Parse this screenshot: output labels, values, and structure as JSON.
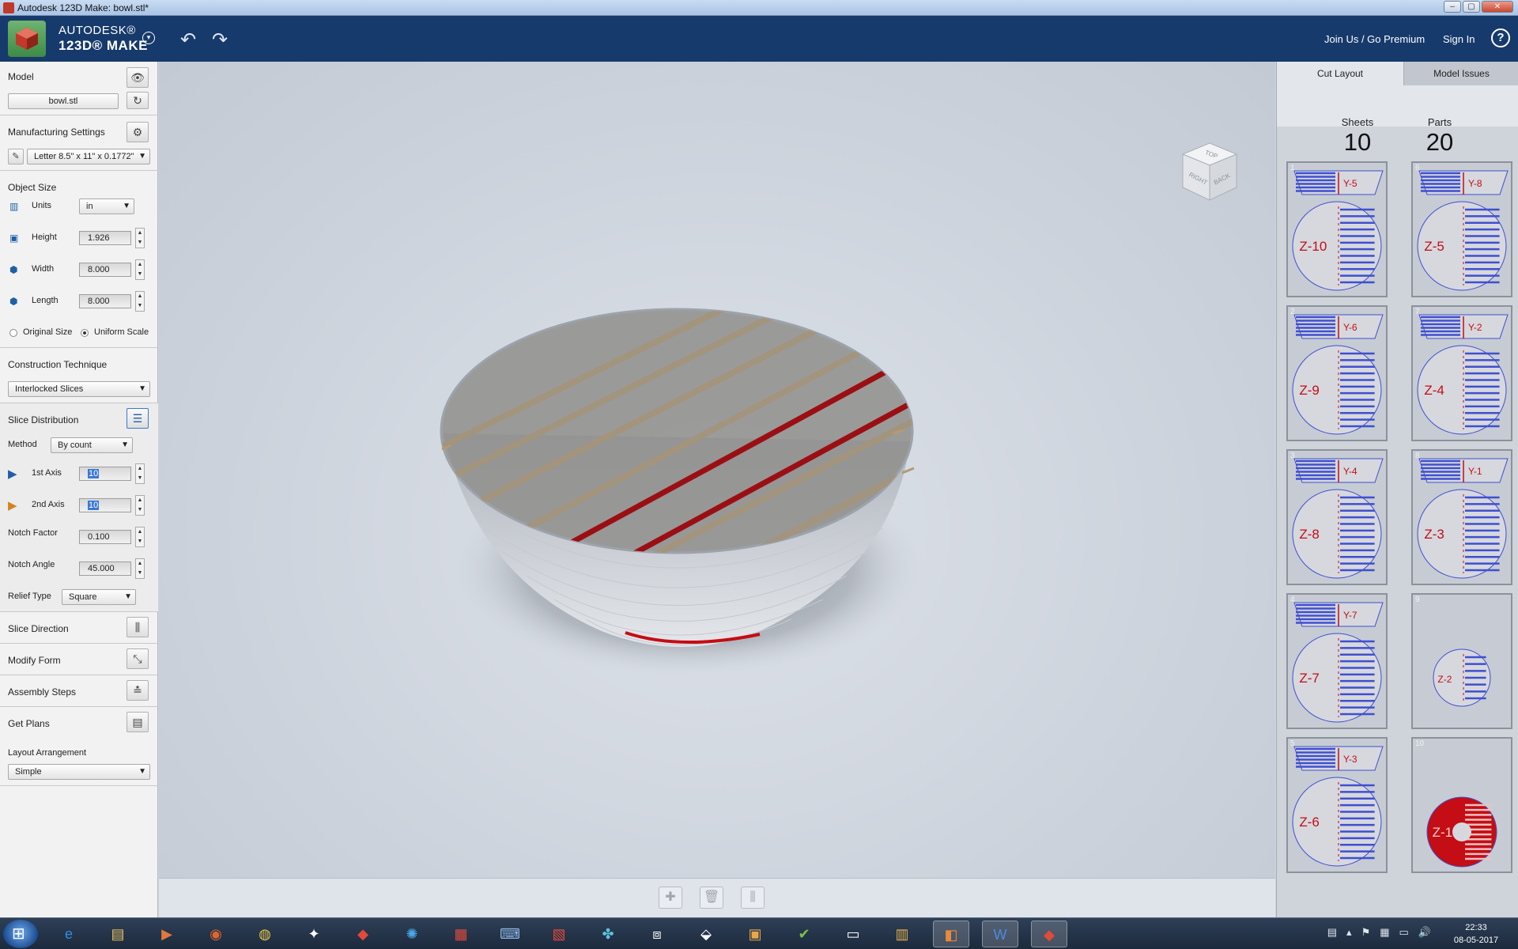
{
  "window": {
    "title": "Autodesk 123D Make: bowl.stl*",
    "buttons": [
      "–",
      "▢",
      "✕"
    ]
  },
  "header": {
    "brand_line1": "AUTODESK®",
    "brand_line2": "123D® MAKE",
    "undo_icon": "undo-arrow-icon",
    "redo_icon": "redo-arrow-icon",
    "join_link": "Join Us / Go Premium",
    "signin_link": "Sign In",
    "help_label": "?"
  },
  "left_panel": {
    "model": {
      "title": "Model",
      "file_button": "bowl.stl"
    },
    "manufacturing": {
      "title": "Manufacturing Settings",
      "sheet_value": "Letter 8.5\" x 11\" x 0.1772\""
    },
    "object_size": {
      "title": "Object Size",
      "units_label": "Units",
      "units_value": "in",
      "height_label": "Height",
      "height_value": "1.926",
      "width_label": "Width",
      "width_value": "8.000",
      "length_label": "Length",
      "length_value": "8.000",
      "original_size_label": "Original Size",
      "uniform_scale_label": "Uniform Scale",
      "selected_scale": "Uniform Scale"
    },
    "construction": {
      "title": "Construction Technique",
      "value": "Interlocked Slices"
    },
    "slice_distribution": {
      "title": "Slice Distribution",
      "method_label": "Method",
      "method_value": "By count",
      "axis1_label": "1st Axis",
      "axis1_value": "10",
      "axis2_label": "2nd Axis",
      "axis2_value": "10",
      "notch_factor_label": "Notch Factor",
      "notch_factor_value": "0.100",
      "notch_angle_label": "Notch Angle",
      "notch_angle_value": "45.000",
      "relief_label": "Relief Type",
      "relief_value": "Square"
    },
    "slice_direction": "Slice Direction",
    "modify_form": "Modify Form",
    "assembly_steps": "Assembly Steps",
    "get_plans": "Get Plans",
    "layout": {
      "title": "Layout Arrangement",
      "value": "Simple"
    }
  },
  "viewcube": {
    "faces": [
      "RIGHT",
      "BACK",
      "TOP"
    ]
  },
  "right_panel": {
    "tabs": [
      "Cut Layout",
      "Model Issues"
    ],
    "active_tab": "Cut Layout",
    "sheets_label": "Sheets",
    "sheets_value": "10",
    "parts_label": "Parts",
    "parts_value": "20",
    "thumbnails": [
      {
        "num": "1",
        "slice_label": "Y-5",
        "disc_label": "Z-10"
      },
      {
        "num": "6",
        "slice_label": "Y-8",
        "disc_label": "Z-5"
      },
      {
        "num": "2",
        "slice_label": "Y-6",
        "disc_label": "Z-9"
      },
      {
        "num": "7",
        "slice_label": "Y-2",
        "disc_label": "Z-4"
      },
      {
        "num": "3",
        "slice_label": "Y-4",
        "disc_label": "Z-8"
      },
      {
        "num": "8",
        "slice_label": "Y-1",
        "disc_label": "Z-3"
      },
      {
        "num": "4",
        "slice_label": "Y-7",
        "disc_label": "Z-7"
      },
      {
        "num": "9",
        "slice_label": "",
        "disc_label": "Z-2"
      },
      {
        "num": "5",
        "slice_label": "Y-3",
        "disc_label": "Z-6"
      },
      {
        "num": "10",
        "slice_label": "",
        "disc_label": "Z-1"
      }
    ]
  },
  "taskbar": {
    "clock_time": "22:33",
    "clock_date": "08-05-2017"
  },
  "colors": {
    "header_bg": "#163a6b",
    "slice_blue": "#3f4fd0",
    "slice_red": "#c40d14",
    "selected_slice": "#9b0f14"
  }
}
